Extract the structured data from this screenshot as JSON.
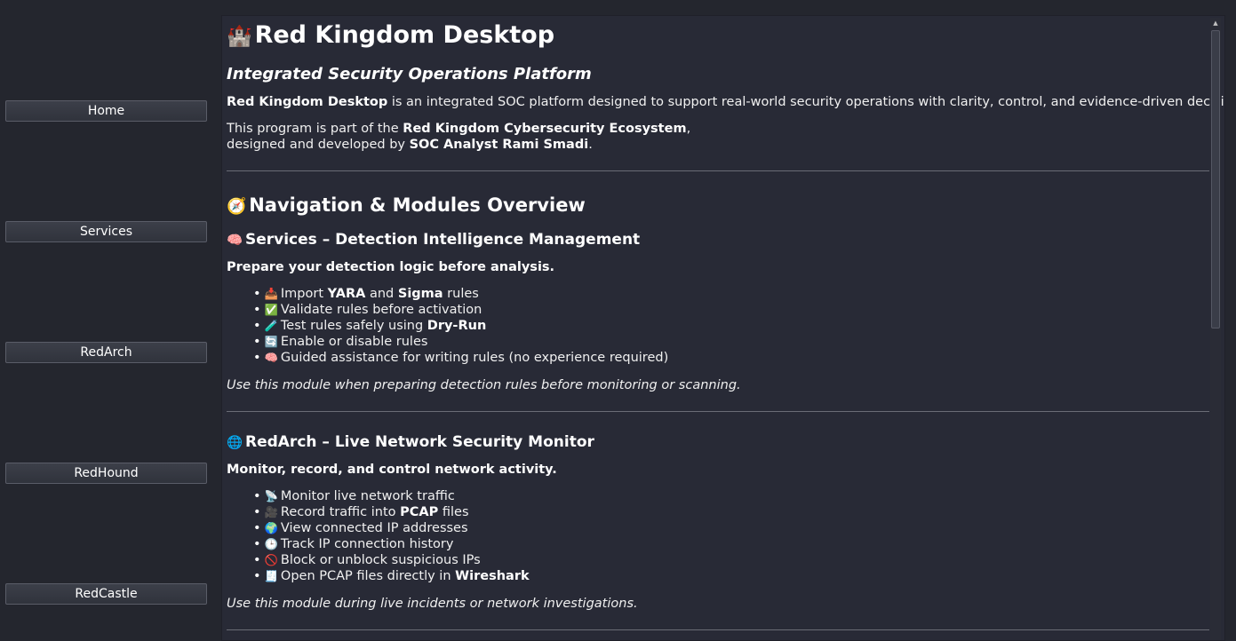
{
  "sidebar": {
    "buttons": [
      "Home",
      "Services",
      "RedArch",
      "RedHound",
      "RedCastle"
    ]
  },
  "header": {
    "icon": "🏰",
    "title": "Red Kingdom Desktop",
    "subtitle": "Integrated Security Operations Platform"
  },
  "intro": {
    "p1_bold": "Red Kingdom Desktop",
    "p1_text": " is an integrated SOC platform designed to support real-world security operations with clarity, control, and evidence-driven decisions.",
    "p2_text_a": "This program is part of the ",
    "p2_bold": "Red Kingdom Cybersecurity Ecosystem",
    "p2_text_b": ",",
    "p3_text_a": "designed and developed by ",
    "p3_bold": "SOC Analyst Rami Smadi",
    "p3_text_b": "."
  },
  "overview": {
    "icon": "🧭",
    "title": "Navigation & Modules Overview"
  },
  "services": {
    "icon": "🧠",
    "title": "Services – Detection Intelligence Management",
    "lead": "Prepare your detection logic before analysis.",
    "usage": "Use this module when preparing detection rules before monitoring or scanning.",
    "items": [
      {
        "icon": "📥",
        "a": "Import ",
        "b1": "YARA",
        "c": " and ",
        "b2": "Sigma",
        "d": " rules"
      },
      {
        "icon": "✅",
        "a": "Validate rules before activation"
      },
      {
        "icon": "🧪",
        "a": "Test rules safely using ",
        "b1": "Dry-Run"
      },
      {
        "icon": "🔄",
        "a": "Enable or disable rules"
      },
      {
        "icon": "🧠",
        "a": "Guided assistance for writing rules (no experience required)"
      }
    ]
  },
  "redarch": {
    "icon": "🌐",
    "title": "RedArch – Live Network Security Monitor",
    "lead": "Monitor, record, and control network activity.",
    "usage": "Use this module during live incidents or network investigations.",
    "items": [
      {
        "icon": "📡",
        "a": "Monitor live network traffic"
      },
      {
        "icon": "🎥",
        "a": "Record traffic into ",
        "b1": "PCAP",
        "c": " files"
      },
      {
        "icon": "🌍",
        "a": "View connected IP addresses"
      },
      {
        "icon": "🕒",
        "a": "Track IP connection history"
      },
      {
        "icon": "🚫",
        "a": "Block or unblock suspicious IPs"
      },
      {
        "icon": "🧾",
        "a": "Open PCAP files directly in ",
        "b1": "Wireshark"
      }
    ]
  }
}
